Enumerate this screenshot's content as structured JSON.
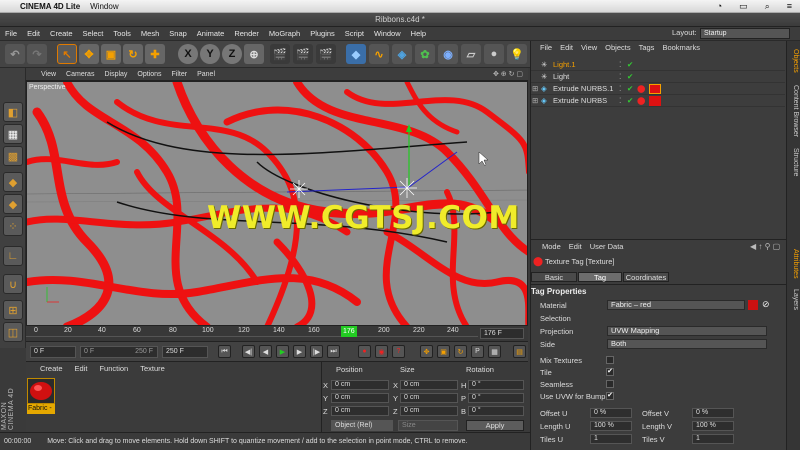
{
  "mac_menubar": {
    "app_name": "CINEMA 4D Lite",
    "menu": "Window"
  },
  "window_title": "Ribbons.c4d *",
  "menubar": [
    "File",
    "Edit",
    "Create",
    "Select",
    "Tools",
    "Mesh",
    "Snap",
    "Animate",
    "Render",
    "MoGraph",
    "Plugins",
    "Script",
    "Window",
    "Help"
  ],
  "layout": {
    "label": "Layout:",
    "value": "Startup"
  },
  "toolbar": {
    "x": "X",
    "y": "Y",
    "z": "Z"
  },
  "viewport": {
    "menu": [
      "View",
      "Cameras",
      "Display",
      "Options",
      "Filter",
      "Panel"
    ],
    "label": "Perspective",
    "watermark": "WWW.CGTSJ.COM"
  },
  "timeline": {
    "ticks": [
      "0",
      "20",
      "40",
      "60",
      "80",
      "100",
      "120",
      "140",
      "160",
      "176",
      "200",
      "220",
      "240"
    ],
    "current": "176 F"
  },
  "playback": {
    "start": "0 F",
    "min": "0 F",
    "max_inner": "250 F",
    "max": "250 F"
  },
  "materials": {
    "menu": [
      "Create",
      "Edit",
      "Function",
      "Texture"
    ],
    "name": "Fabric -",
    "brand": "MAXON CINEMA 4D"
  },
  "coordinates": {
    "headers": [
      "Position",
      "Size",
      "Rotation"
    ],
    "rows": [
      {
        "axis": "X",
        "pos": "0 cm",
        "size": "0 cm",
        "rot_axis": "H",
        "rot": "0 °"
      },
      {
        "axis": "Y",
        "pos": "0 cm",
        "size": "0 cm",
        "rot_axis": "P",
        "rot": "0 °"
      },
      {
        "axis": "Z",
        "pos": "0 cm",
        "size": "0 cm",
        "rot_axis": "B",
        "rot": "0 °"
      }
    ],
    "mode": "Object (Rel)",
    "size_mode": "Size",
    "apply": "Apply"
  },
  "status": {
    "time": "00:00:00",
    "text": "Move: Click and drag to move elements. Hold down SHIFT to quantize movement / add to the selection in point mode, CTRL to remove."
  },
  "objects": {
    "menu": [
      "File",
      "Edit",
      "View",
      "Objects",
      "Tags",
      "Bookmarks"
    ],
    "items": [
      "Light.1",
      "Light",
      "Extrude NURBS.1",
      "Extrude NURBS"
    ]
  },
  "attributes": {
    "menu": [
      "Mode",
      "Edit",
      "User Data"
    ],
    "title": "Texture Tag [Texture]",
    "tabs": [
      "Basic",
      "Tag",
      "Coordinates"
    ],
    "section": "Tag Properties",
    "material_label": "Material",
    "material_value": "Fabric – red",
    "selection_label": "Selection",
    "projection_label": "Projection",
    "projection_value": "UVW Mapping",
    "side_label": "Side",
    "side_value": "Both",
    "mix_label": "Mix Textures",
    "tile_label": "Tile",
    "seamless_label": "Seamless",
    "uvw_label": "Use UVW for Bump",
    "offset_u_label": "Offset U",
    "offset_u": "0 %",
    "offset_v_label": "Offset V",
    "offset_v": "0 %",
    "length_u_label": "Length U",
    "length_u": "100 %",
    "length_v_label": "Length V",
    "length_v": "100 %",
    "tiles_u_label": "Tiles U",
    "tiles_u": "1",
    "tiles_v_label": "Tiles V",
    "tiles_v": "1"
  },
  "side_tabs": [
    "Objects",
    "Content Browser",
    "Structure",
    "Attributes",
    "Layers"
  ]
}
